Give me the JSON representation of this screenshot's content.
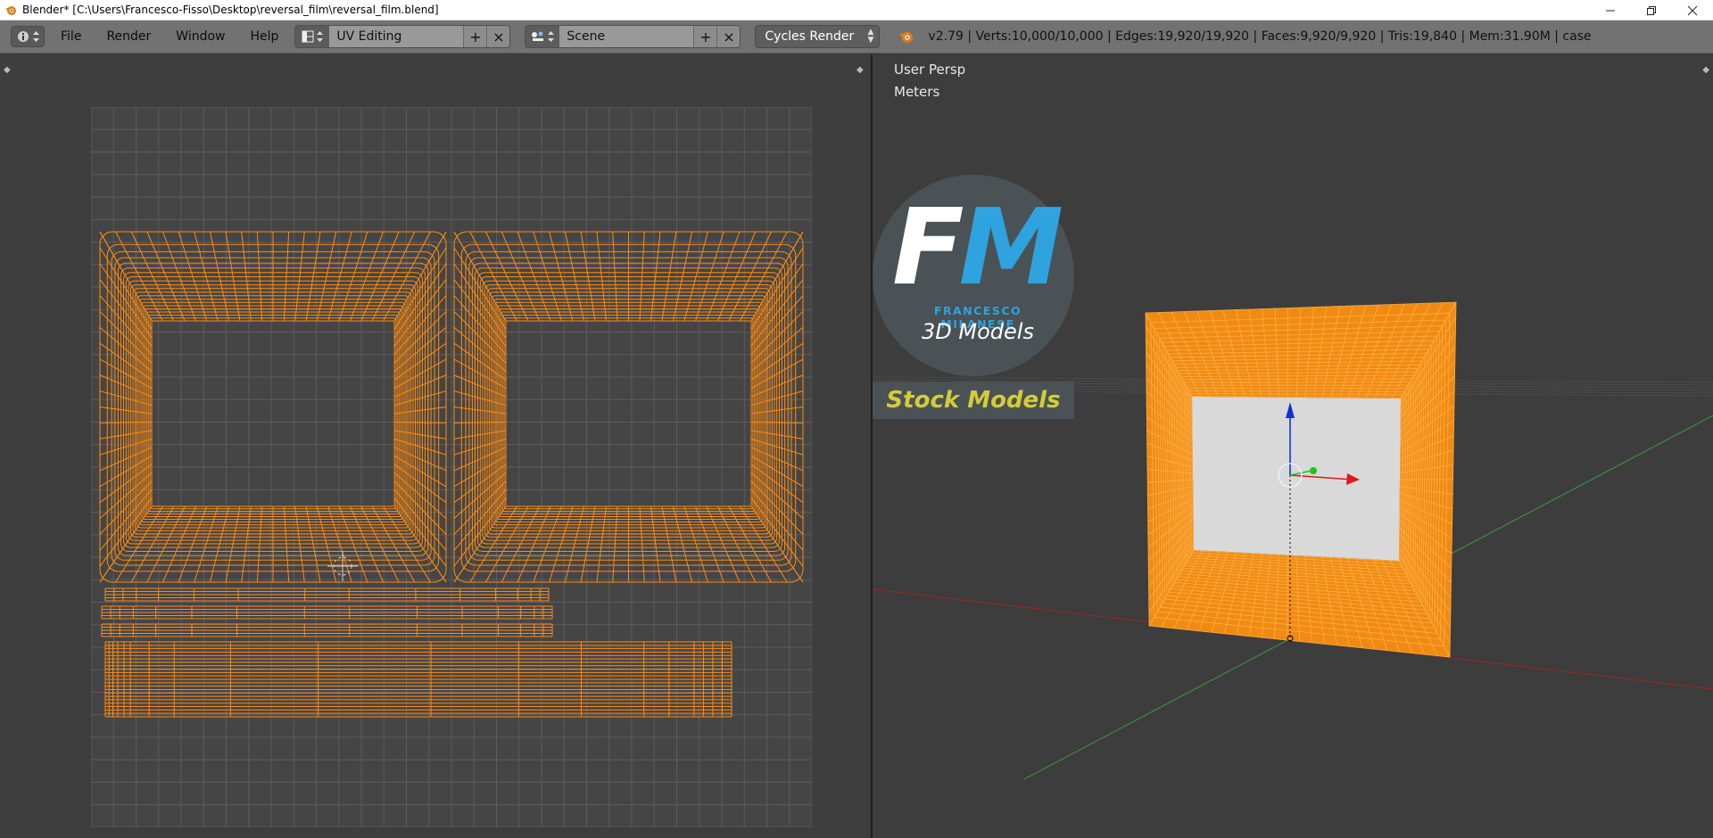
{
  "titlebar": {
    "title": "Blender* [C:\\Users\\Francesco-Fisso\\Desktop\\reversal_film\\reversal_film.blend]",
    "icon": "blender-icon",
    "controls": [
      "minimize-icon",
      "restore-icon",
      "close-icon"
    ]
  },
  "menubar": {
    "editor_type_icon": "info-icon",
    "menus": [
      "File",
      "Render",
      "Window",
      "Help"
    ],
    "screen_layout": {
      "icon": "layout-icon",
      "value": "UV Editing",
      "add": "+",
      "remove": "×"
    },
    "scene": {
      "icon": "scene-icon",
      "value": "Scene",
      "add": "+",
      "remove": "×"
    },
    "render_engine": "Cycles Render",
    "stats": "v2.79 | Verts:10,000/10,000 | Edges:19,920/19,920 | Faces:9,920/9,920 | Tris:19,840 | Mem:31.90M | case"
  },
  "uv_editor": {
    "icon": "uv-editor-icon"
  },
  "viewport": {
    "perspective": "User Persp",
    "units": "Meters",
    "logo": {
      "initial_f": "F",
      "initial_m": "M",
      "name": "FRANCESCO MILANESE",
      "subtitle": "3D Models",
      "banner": "Stock Models"
    }
  },
  "colors": {
    "wire": "#ff8c10",
    "uv_background": "#3e3e3e",
    "grid_dark": "#454545",
    "grid_line": "#5c5c5c",
    "logo_blue": "#2ea3df",
    "logo_banner_text": "#d4cc38",
    "axis_x": "#e01818",
    "axis_y": "#1ec51e",
    "axis_z": "#1230d8"
  }
}
